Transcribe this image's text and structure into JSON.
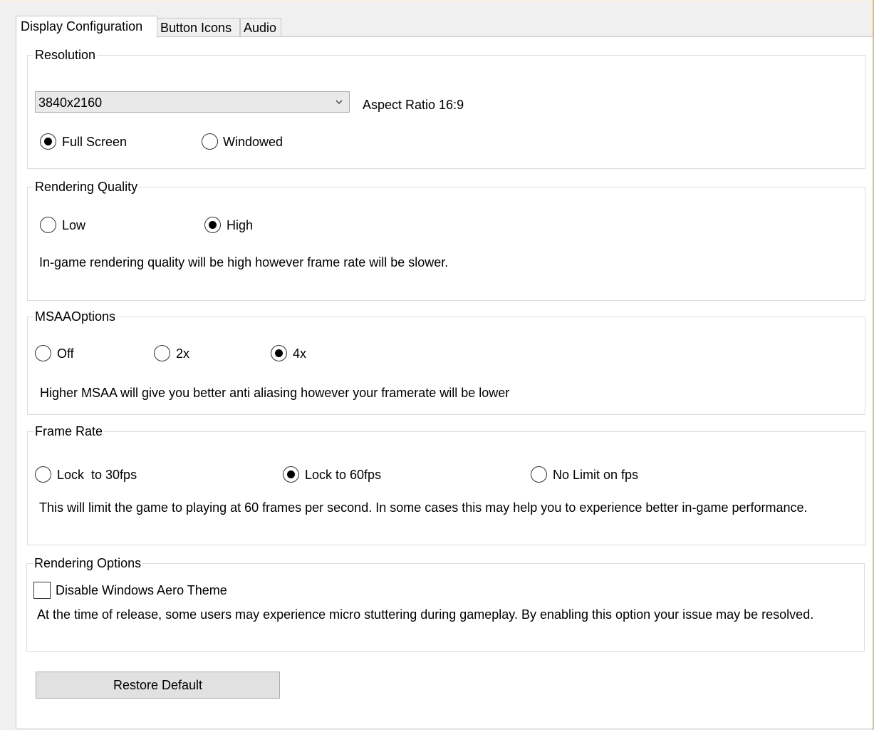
{
  "tabs": [
    {
      "label": "Display Configuration",
      "active": true
    },
    {
      "label": "Button Icons",
      "active": false
    },
    {
      "label": "Audio",
      "active": false
    }
  ],
  "resolution": {
    "title": "Resolution",
    "selected": "3840x2160",
    "aspect_ratio": "Aspect Ratio 16:9",
    "options": [
      {
        "label": "Full Screen",
        "checked": true
      },
      {
        "label": "Windowed",
        "checked": false
      }
    ]
  },
  "rendering_quality": {
    "title": "Rendering Quality",
    "options": [
      {
        "label": "Low",
        "checked": false
      },
      {
        "label": "High",
        "checked": true
      }
    ],
    "description": "In-game rendering quality will be high however frame rate will be slower."
  },
  "msaa": {
    "title": "MSAAOptions",
    "options": [
      {
        "label": "Off",
        "checked": false
      },
      {
        "label": "2x",
        "checked": false
      },
      {
        "label": "4x",
        "checked": true
      }
    ],
    "description": "Higher MSAA will give you better anti aliasing however your framerate will be lower"
  },
  "frame_rate": {
    "title": "Frame Rate",
    "options": [
      {
        "label": "Lock  to 30fps",
        "checked": false
      },
      {
        "label": "Lock to 60fps",
        "checked": true
      },
      {
        "label": "No Limit on fps",
        "checked": false
      }
    ],
    "description": "This will limit the game to playing at 60 frames per second. In some cases this may help you to experience better in-game performance."
  },
  "rendering_options": {
    "title": "Rendering Options",
    "checkbox_label": "Disable Windows Aero Theme",
    "checked": false,
    "description": "At the time of release, some users may experience micro stuttering during gameplay. By enabling this option your issue may be resolved."
  },
  "restore_button": "Restore Default",
  "icons": {
    "combo_arrow": "chevron-down-icon"
  }
}
